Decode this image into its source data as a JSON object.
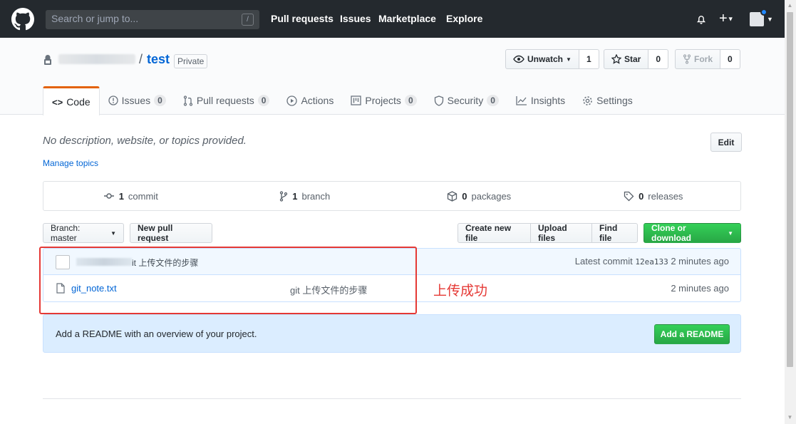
{
  "navbar": {
    "search_placeholder": "Search or jump to...",
    "search_shortcut": "/",
    "links": [
      "Pull requests",
      "Issues",
      "Marketplace",
      "Explore"
    ],
    "plus": "+"
  },
  "repo": {
    "separator": "/",
    "name": "test",
    "visibility": "Private",
    "watch_label": "Unwatch",
    "watch_count": "1",
    "star_label": "Star",
    "star_count": "0",
    "fork_label": "Fork",
    "fork_count": "0"
  },
  "tabs": [
    {
      "label": "Code",
      "count": ""
    },
    {
      "label": "Issues",
      "count": "0"
    },
    {
      "label": "Pull requests",
      "count": "0"
    },
    {
      "label": "Actions",
      "count": ""
    },
    {
      "label": "Projects",
      "count": "0"
    },
    {
      "label": "Security",
      "count": "0"
    },
    {
      "label": "Insights",
      "count": ""
    },
    {
      "label": "Settings",
      "count": ""
    }
  ],
  "about": {
    "description": "No description, website, or topics provided.",
    "manage_topics": "Manage topics",
    "edit": "Edit"
  },
  "summary": {
    "commits_num": "1",
    "commits_label": "commit",
    "branches_num": "1",
    "branches_label": "branch",
    "packages_num": "0",
    "packages_label": "packages",
    "releases_num": "0",
    "releases_label": "releases"
  },
  "file_nav": {
    "branch": "Branch: master",
    "new_pr": "New pull request",
    "create_file": "Create new file",
    "upload_files": "Upload files",
    "find_file": "Find file",
    "clone": "Clone or download"
  },
  "commit": {
    "message": "it 上传文件的步骤",
    "latest_label": "Latest commit",
    "sha": "12ea133",
    "time": "2 minutes ago"
  },
  "files": [
    {
      "name": "git_note.txt",
      "message": "git 上传文件的步骤",
      "age": "2 minutes ago"
    }
  ],
  "annotation": "上传成功",
  "readme": {
    "text": "Add a README with an overview of your project.",
    "button": "Add a README"
  },
  "colors": {
    "navbar": "#24292e",
    "link": "#0366d6",
    "green": "#28a745",
    "annotation": "#e53935"
  }
}
